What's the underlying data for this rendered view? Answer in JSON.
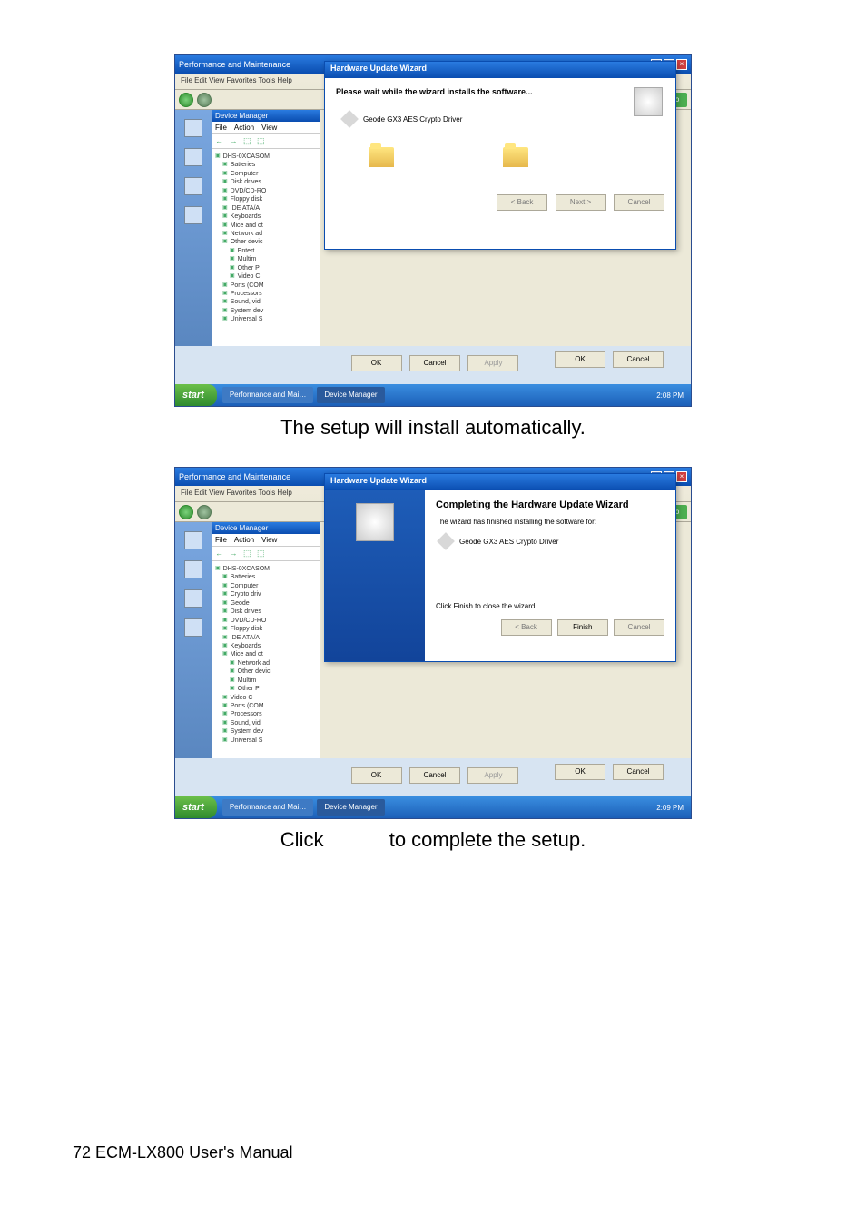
{
  "screenshot1": {
    "outer_window_title": "Performance and Maintenance",
    "outer_menu": "File   Edit   View   Favorites   Tools   Help",
    "go_label": "Go",
    "device_manager": {
      "title": "Device Manager",
      "menu_file": "File",
      "menu_action": "Action",
      "menu_view": "View",
      "toolbar": "← → ⬚ ⬚",
      "root": "DHS-0XCASOM",
      "items": [
        "Batteries",
        "Computer",
        "Disk drives",
        "DVD/CD-RO",
        "Floppy disk",
        "IDE ATA/A",
        "Keyboards",
        "Mice and ot",
        "Network ad",
        "Other devic",
        "Entert",
        "Multim",
        "Other P",
        "Video C",
        "Ports (COM",
        "Processors",
        "Sound, vid",
        "System dev",
        "Universal S"
      ]
    },
    "wizard": {
      "title": "Hardware Update Wizard",
      "heading": "Please wait while the wizard installs the software...",
      "driver_name": "Geode GX3 AES Crypto Driver",
      "btn_back": "< Back",
      "btn_next": "Next >",
      "btn_cancel": "Cancel"
    },
    "prop_ok": "OK",
    "prop_cancel": "Cancel",
    "bottom_ok": "OK",
    "bottom_cancel": "Cancel",
    "bottom_apply": "Apply",
    "taskbar": {
      "start": "start",
      "item1": "Performance and Mai…",
      "item2": "Device Manager",
      "time": "2:08 PM"
    }
  },
  "caption1": "The setup will install automatically.",
  "screenshot2": {
    "outer_window_title": "Performance and Maintenance",
    "outer_menu": "File   Edit   View   Favorites   Tools   Help",
    "go_label": "Go",
    "device_manager": {
      "title": "Device Manager",
      "menu_file": "File",
      "menu_action": "Action",
      "menu_view": "View",
      "toolbar": "← → ⬚ ⬚",
      "root": "DHS-0XCASOM",
      "items": [
        "Batteries",
        "Computer",
        "Crypto driv",
        "Geode",
        "Disk drives",
        "DVD/CD-RO",
        "Floppy disk",
        "IDE ATA/A",
        "Keyboards",
        "Mice and ot",
        "Network ad",
        "Other devic",
        "Multim",
        "Other P",
        "Video C",
        "Ports (COM",
        "Processors",
        "Sound, vid",
        "System dev",
        "Universal S"
      ]
    },
    "wizard": {
      "title": "Hardware Update Wizard",
      "heading": "Completing the Hardware Update Wizard",
      "line1": "The wizard has finished installing the software for:",
      "driver_name": "Geode GX3 AES Crypto Driver",
      "closing": "Click Finish to close the wizard.",
      "btn_back": "< Back",
      "btn_finish": "Finish",
      "btn_cancel": "Cancel"
    },
    "prop_ok": "OK",
    "prop_cancel": "Cancel",
    "bottom_ok": "OK",
    "bottom_cancel": "Cancel",
    "bottom_apply": "Apply",
    "taskbar": {
      "start": "start",
      "item1": "Performance and Mai…",
      "item2": "Device Manager",
      "time": "2:09 PM"
    }
  },
  "caption2_left": "Click",
  "caption2_right": "to complete the setup.",
  "footer": "72 ECM-LX800 User's Manual"
}
